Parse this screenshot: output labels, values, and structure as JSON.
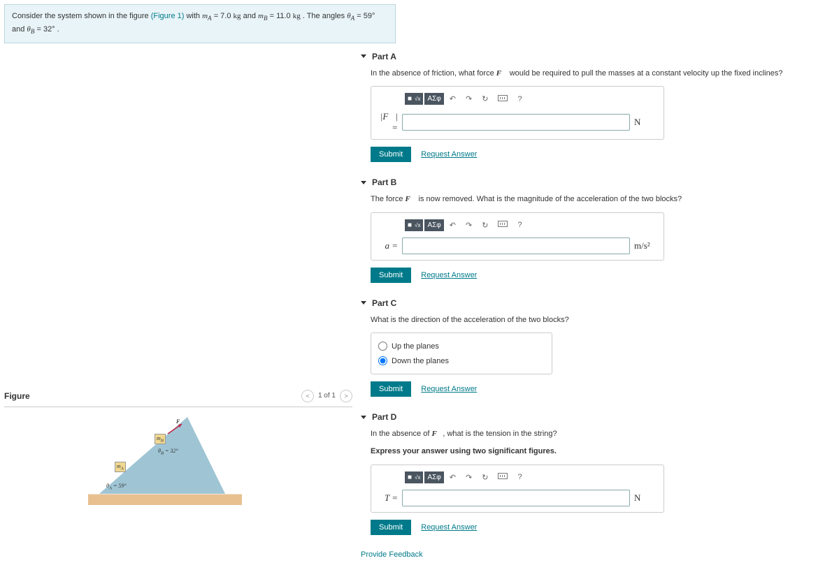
{
  "problem": {
    "prefix": "Consider the system shown in the figure ",
    "figlink": "(Figure 1)",
    "mid1": " with ",
    "mA_sym": "m",
    "mA_sub": "A",
    "mA_eq": " = 7.0 ",
    "mA_unit": "kg",
    "and1": " and ",
    "mB_sym": "m",
    "mB_sub": "B",
    "mB_eq": " = 11.0 ",
    "mB_unit": "kg",
    "mid2": " . The angles ",
    "thA_sym": "θ",
    "thA_sub": "A",
    "thA_eq": " = 59° ",
    "and2": "and ",
    "thB_sym": "θ",
    "thB_sub": "B",
    "thB_eq": " = 32° ."
  },
  "figure": {
    "title": "Figure",
    "pager": "1 of 1",
    "thetaA": "θ",
    "thetaA_sub": "A",
    "thetaA_val": " = 59°",
    "thetaB": "θ",
    "thetaB_sub": "B",
    "thetaB_val": " = 32°",
    "mA": "m",
    "mA_sub": "A",
    "mB": "m",
    "mB_sub": "B",
    "F": "F"
  },
  "toolbar": {
    "greek": "ΑΣφ",
    "help": "?"
  },
  "buttons": {
    "submit": "Submit",
    "request": "Request Answer"
  },
  "partA": {
    "title": "Part A",
    "prompt_pre": "In the absence of friction, what force ",
    "prompt_vec": "F⃗",
    "prompt_post": " would be required to pull the masses at a constant velocity up the fixed inclines?",
    "var": "|F⃗| =",
    "unit": "N"
  },
  "partB": {
    "title": "Part B",
    "prompt_pre": "The force ",
    "prompt_vec": "F⃗",
    "prompt_post": " is now removed. What is the magnitude of the acceleration of the two blocks?",
    "var": "a =",
    "unit": "m/s²"
  },
  "partC": {
    "title": "Part C",
    "prompt": "What is the direction of the acceleration of the two blocks?",
    "opt1": "Up the planes",
    "opt2": "Down the planes"
  },
  "partD": {
    "title": "Part D",
    "prompt_pre": "In the absence of ",
    "prompt_vec": "F⃗",
    "prompt_post": ", what is the tension in the string?",
    "express": "Express your answer using two significant figures.",
    "var": "T =",
    "unit": "N"
  },
  "feedback": "Provide Feedback"
}
